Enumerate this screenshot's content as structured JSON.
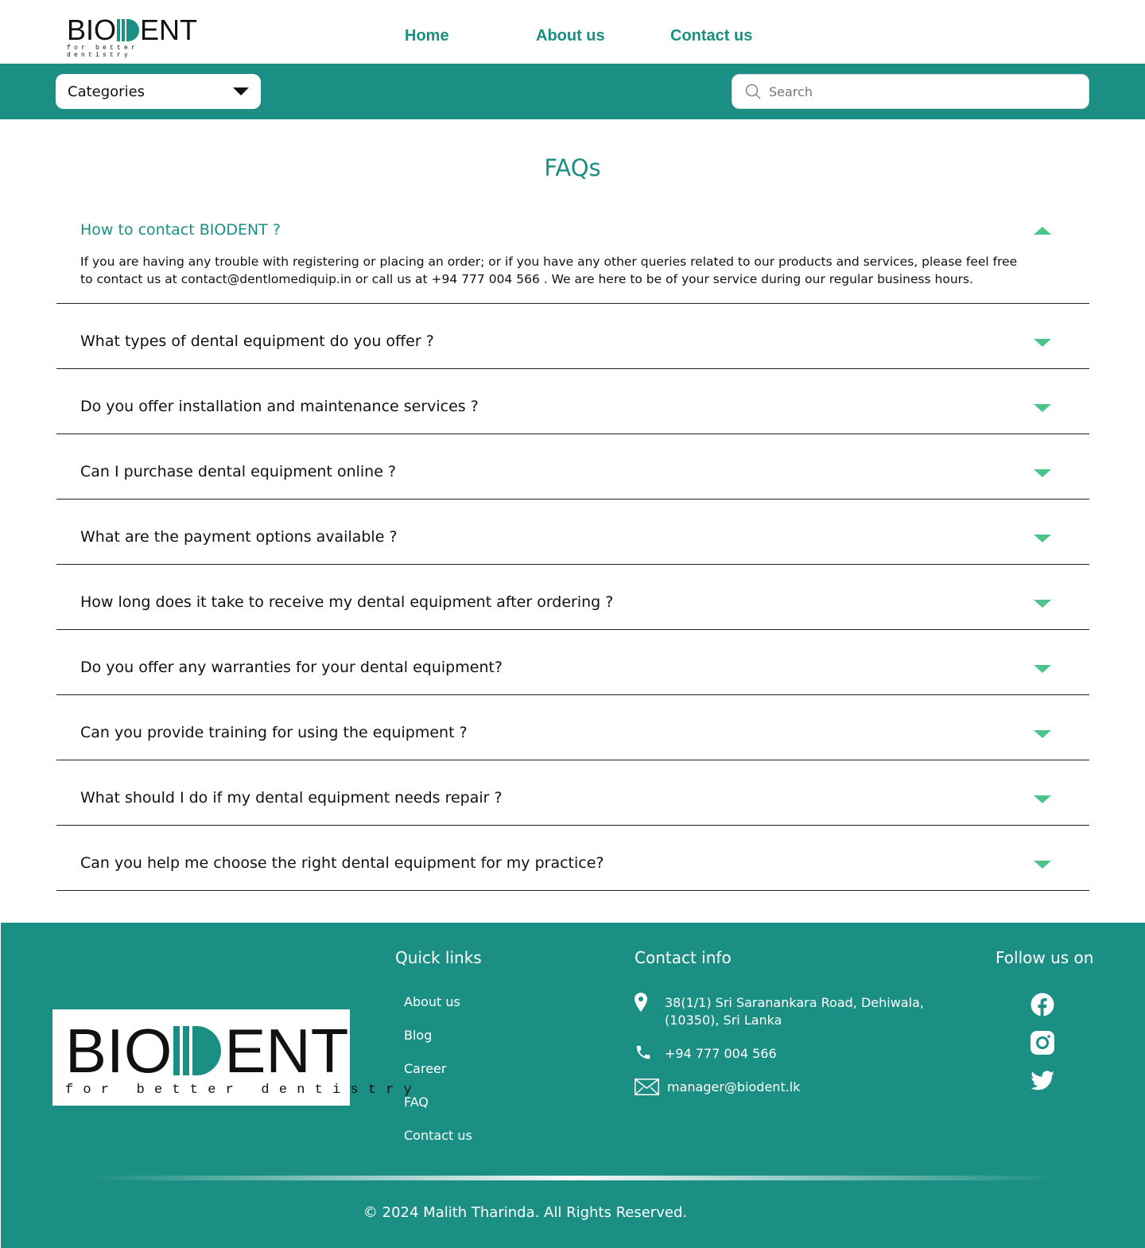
{
  "brand": {
    "logo_letters_left": "BIO",
    "logo_letters_right": "ENT",
    "tagline": "for better dentistry",
    "accent_color": "#1b8f83",
    "arrow_color": "#4cc38a"
  },
  "nav": {
    "items": [
      {
        "label": "Home"
      },
      {
        "label": "About us"
      },
      {
        "label": "Contact us"
      }
    ]
  },
  "toolbar": {
    "categories_label": "Categories",
    "search_placeholder": "Search"
  },
  "faq": {
    "title": "FAQs",
    "items": [
      {
        "question": "How to contact BIODENT ?",
        "expanded": true,
        "answer": "If you are having any trouble with registering or placing an order; or if you have any other queries related to our products and services, please feel free to contact us at contact@dentlomediquip.in or call us at +94 777 004 566  . We are here to be of your service during our regular business hours."
      },
      {
        "question": "What types of dental equipment do you offer ?",
        "expanded": false
      },
      {
        "question": "Do you offer installation and maintenance services ?",
        "expanded": false
      },
      {
        "question": "Can I purchase dental equipment online ?",
        "expanded": false
      },
      {
        "question": "What are the payment options available ?",
        "expanded": false
      },
      {
        "question": "How long does it take to receive my dental equipment after ordering ?",
        "expanded": false
      },
      {
        "question": "Do you offer any warranties for your dental equipment?",
        "expanded": false
      },
      {
        "question": "Can you provide training for using the equipment ?",
        "expanded": false
      },
      {
        "question": "What should I do if my dental equipment needs repair ?",
        "expanded": false
      },
      {
        "question": "Can you help me choose the right dental equipment for my practice?",
        "expanded": false
      }
    ]
  },
  "footer": {
    "quick_links_title": "Quick links",
    "quick_links": [
      "About us",
      "Blog",
      "Career",
      "FAQ",
      "Contact us"
    ],
    "contact_title": "Contact info",
    "address_line1": "38(1/1) Sri Saranankara Road, Dehiwala,",
    "address_line2": "(10350), Sri Lanka",
    "phone": "+94 777 004 566",
    "email": "manager@biodent.lk",
    "follow_title": "Follow us on",
    "social": [
      "facebook-icon",
      "instagram-icon",
      "twitter-icon"
    ],
    "copyright": "© 2024 Malith Tharinda. All Rights Reserved."
  }
}
